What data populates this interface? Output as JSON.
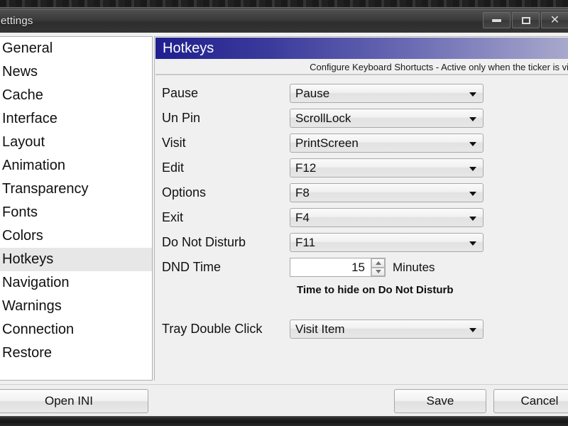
{
  "window": {
    "title": "ettings",
    "controls": [
      {
        "name": "minimize",
        "glyph": "minimize-icon"
      },
      {
        "name": "maximize",
        "glyph": "maximize-icon"
      },
      {
        "name": "close",
        "glyph": "close-icon",
        "label": "✕"
      }
    ]
  },
  "sidebar": {
    "items": [
      {
        "label": "General",
        "selected": false
      },
      {
        "label": "News",
        "selected": false
      },
      {
        "label": "Cache",
        "selected": false
      },
      {
        "label": "Interface",
        "selected": false
      },
      {
        "label": "Layout",
        "selected": false
      },
      {
        "label": "Animation",
        "selected": false
      },
      {
        "label": "Transparency",
        "selected": false
      },
      {
        "label": "Fonts",
        "selected": false
      },
      {
        "label": "Colors",
        "selected": false
      },
      {
        "label": "Hotkeys",
        "selected": true
      },
      {
        "label": "Navigation",
        "selected": false
      },
      {
        "label": "Warnings",
        "selected": false
      },
      {
        "label": "Connection",
        "selected": false
      },
      {
        "label": "Restore",
        "selected": false
      }
    ]
  },
  "panel": {
    "header": "Hotkeys",
    "subtitle": "Configure Keyboard Shortucts - Active only when the ticker is vi",
    "rows": [
      {
        "label": "Pause",
        "value": "Pause"
      },
      {
        "label": "Un Pin",
        "value": "ScrollLock"
      },
      {
        "label": "Visit",
        "value": "PrintScreen"
      },
      {
        "label": "Edit",
        "value": "F12"
      },
      {
        "label": "Options",
        "value": "F8"
      },
      {
        "label": "Exit",
        "value": "F4"
      },
      {
        "label": "Do Not Disturb",
        "value": "F11"
      }
    ],
    "dnd_time": {
      "label": "DND Time",
      "value": "15",
      "unit": "Minutes",
      "hint": "Time to hide on Do Not Disturb"
    },
    "tray_double_click": {
      "label": "Tray Double Click",
      "value": "Visit Item"
    }
  },
  "footer": {
    "open_ini": "Open INI",
    "save": "Save",
    "cancel": "Cancel"
  },
  "colors": {
    "header_gradient_start": "#1f1f8f",
    "header_gradient_end": "#a9a9cd",
    "selected_nav_bg": "#e7e7e7",
    "window_bg": "#f0f0f0"
  }
}
